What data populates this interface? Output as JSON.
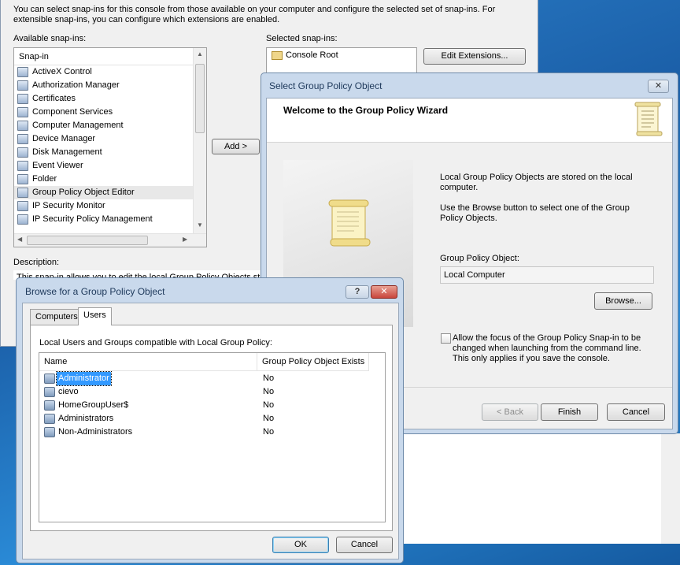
{
  "snapins_window": {
    "intro": "You can select snap-ins for this console from those available on your computer and configure the selected set of snap-ins. For extensible snap-ins, you can configure which extensions are enabled.",
    "available_label": "Available snap-ins:",
    "available_header": "Snap-in",
    "available_items": [
      "ActiveX Control",
      "Authorization Manager",
      "Certificates",
      "Component Services",
      "Computer Management",
      "Device Manager",
      "Disk Management",
      "Event Viewer",
      "Folder",
      "Group Policy Object Editor",
      "IP Security Monitor",
      "IP Security Policy Management"
    ],
    "selected_label": "Selected snap-ins:",
    "selected_items": [
      "Console Root"
    ],
    "edit_extensions_button": "Edit Extensions...",
    "add_button": "Add >",
    "description_label": "Description:",
    "description_text": "This snap-in allows you to edit the local Group Policy Objects st"
  },
  "wizard": {
    "title": "Select Group Policy Object",
    "close_label": "✕",
    "heading": "Welcome to the Group Policy Wizard",
    "text1": "Local Group Policy Objects are stored on the local computer.",
    "text2": "Use the Browse button to select one of the Group Policy Objects.",
    "gpo_label": "Group Policy Object:",
    "gpo_value": "Local Computer",
    "browse_button": "Browse...",
    "checkbox_label": "Allow the focus of the Group Policy Snap-in to be changed when launching from the command line.  This only applies if you save the console.",
    "back_button": "< Back",
    "finish_button": "Finish",
    "cancel_button": "Cancel"
  },
  "browse_dialog": {
    "title": "Browse for a Group Policy Object",
    "help_label": "?",
    "tabs": [
      "Computers",
      "Users"
    ],
    "active_tab": "Users",
    "list_caption": "Local Users and Groups compatible with Local Group Policy:",
    "columns": [
      "Name",
      "Group Policy Object Exists"
    ],
    "rows": [
      {
        "name": "Administrator",
        "exists": "No"
      },
      {
        "name": "cievo",
        "exists": "No"
      },
      {
        "name": "HomeGroupUser$",
        "exists": "No"
      },
      {
        "name": "Administrators",
        "exists": "No"
      },
      {
        "name": "Non-Administrators",
        "exists": "No"
      }
    ],
    "selected_row": "Administrator",
    "ok_button": "OK",
    "cancel_button": "Cancel"
  },
  "colors": {
    "selection": "#3399ff",
    "close_button": "#c9463d",
    "title_text": "#1e395b"
  }
}
